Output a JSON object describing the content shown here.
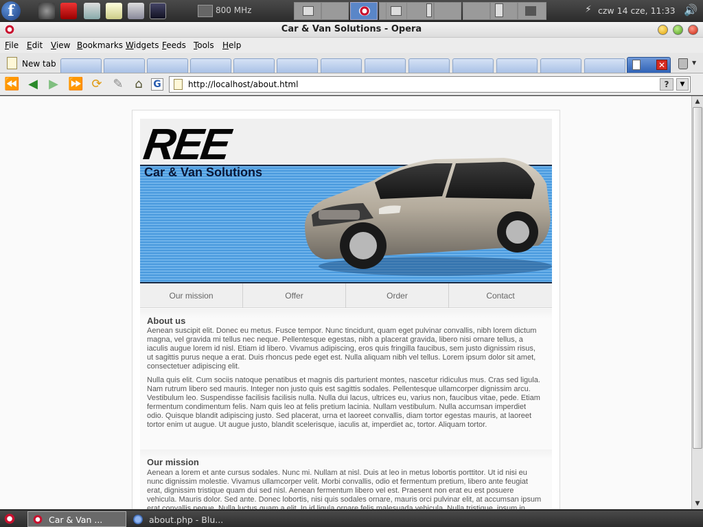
{
  "top_panel": {
    "cpu_label": "800 MHz",
    "clock": "czw 14 cze, 11:33"
  },
  "window": {
    "title": "Car & Van Solutions - Opera"
  },
  "menu": [
    "File",
    "Edit",
    "View",
    "Bookmarks",
    "Widgets",
    "Feeds",
    "Tools",
    "Help"
  ],
  "tabs": {
    "new_tab_label": "New tab",
    "close_glyph": "✕"
  },
  "address_bar": {
    "url": "http://localhost/about.html",
    "help_glyph": "?"
  },
  "site": {
    "logo": "REE",
    "tagline": "Car & Van Solutions",
    "nav": [
      "Our mission",
      "Offer",
      "Order",
      "Contact"
    ],
    "about": {
      "heading": "About us",
      "paragraph1": "Aenean suscipit elit. Donec eu metus. Fusce tempor. Nunc tincidunt, quam eget pulvinar convallis, nibh lorem dictum magna, vel gravida mi tellus nec neque. Pellentesque egestas, nibh a placerat gravida, libero nisi ornare tellus, a iaculis augue lorem id nisl. Etiam id libero. Vivamus adipiscing, eros quis fringilla faucibus, sem justo dignissim risus, ut sagittis purus neque a erat. Duis rhoncus pede eget est. Nulla aliquam nibh vel tellus. Lorem ipsum dolor sit amet, consectetuer adipiscing elit.",
      "paragraph2": "Nulla quis elit. Cum sociis natoque penatibus et magnis dis parturient montes, nascetur ridiculus mus. Cras sed ligula. Nam rutrum libero sed mauris. Integer non justo quis est sagittis sodales. Pellentesque ullamcorper dignissim arcu. Vestibulum leo. Suspendisse facilisis facilisis nulla. Nulla dui lacus, ultrices eu, varius non, faucibus vitae, pede. Etiam fermentum condimentum felis. Nam quis leo at felis pretium lacinia. Nullam vestibulum. Nulla accumsan imperdiet odio. Quisque blandit adipiscing justo. Sed placerat, urna et laoreet convallis, diam tortor egestas mauris, at laoreet tortor enim ut augue. Ut augue justo, blandit scelerisque, iaculis at, imperdiet ac, tortor. Aliquam tortor."
    },
    "mission": {
      "heading": "Our mission",
      "paragraph1": "Aenean a lorem et ante cursus sodales. Nunc mi. Nullam at nisl. Duis at leo in metus lobortis porttitor. Ut id nisi eu nunc dignissim molestie. Vivamus ullamcorper velit. Morbi convallis, odio et fermentum pretium, libero ante feugiat erat, dignissim tristique quam dui sed nisl. Aenean fermentum libero vel est. Praesent non erat eu est posuere vehicula. Mauris dolor. Sed ante. Donec lobortis, nisi quis sodales ornare, mauris orci pulvinar elit, at accumsan ipsum erat convallis neque. Nulla luctus quam a elit. In id ligula ornare felis malesuada vehicula. Nulla tristique, ipsum in tincidunt varius, nibh nibh dapibus sapien, id imperdiet metus sem in odio."
    }
  },
  "taskbar": {
    "items": [
      "Car & Van ...",
      "about.php - Blu..."
    ]
  },
  "colors": {
    "header_blue": "#4a9ade",
    "tab_active": "#2f62b6",
    "panel": "#2c2c2c"
  }
}
